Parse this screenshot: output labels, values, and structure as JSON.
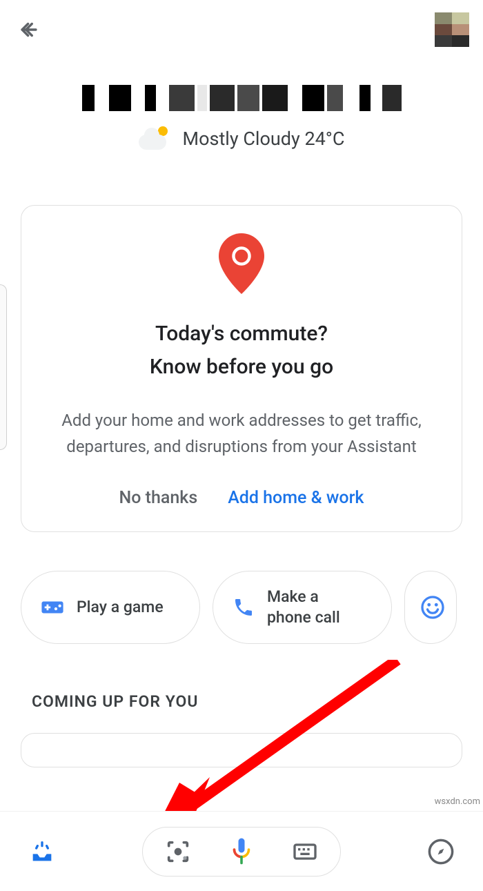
{
  "weather": {
    "summary": "Mostly Cloudy 24°C"
  },
  "commute_card": {
    "title_line1": "Today's commute?",
    "title_line2": "Know before you go",
    "description": "Add your home and work addresses to get traffic, departures, and disruptions from your Assistant",
    "no_label": "No thanks",
    "add_label": "Add home & work"
  },
  "chips": {
    "play_game": "Play a game",
    "phone_call": "Make a phone call"
  },
  "sections": {
    "coming_up": "COMING UP FOR YOU"
  },
  "footer_attribution": "wsxdn.com",
  "colors": {
    "accent_blue": "#1a73e8",
    "google_blue": "#4285F4",
    "google_red": "#EA4335",
    "google_yellow": "#FBBC04",
    "google_green": "#34A853",
    "text_primary": "#202124",
    "text_secondary": "#5f6368"
  }
}
